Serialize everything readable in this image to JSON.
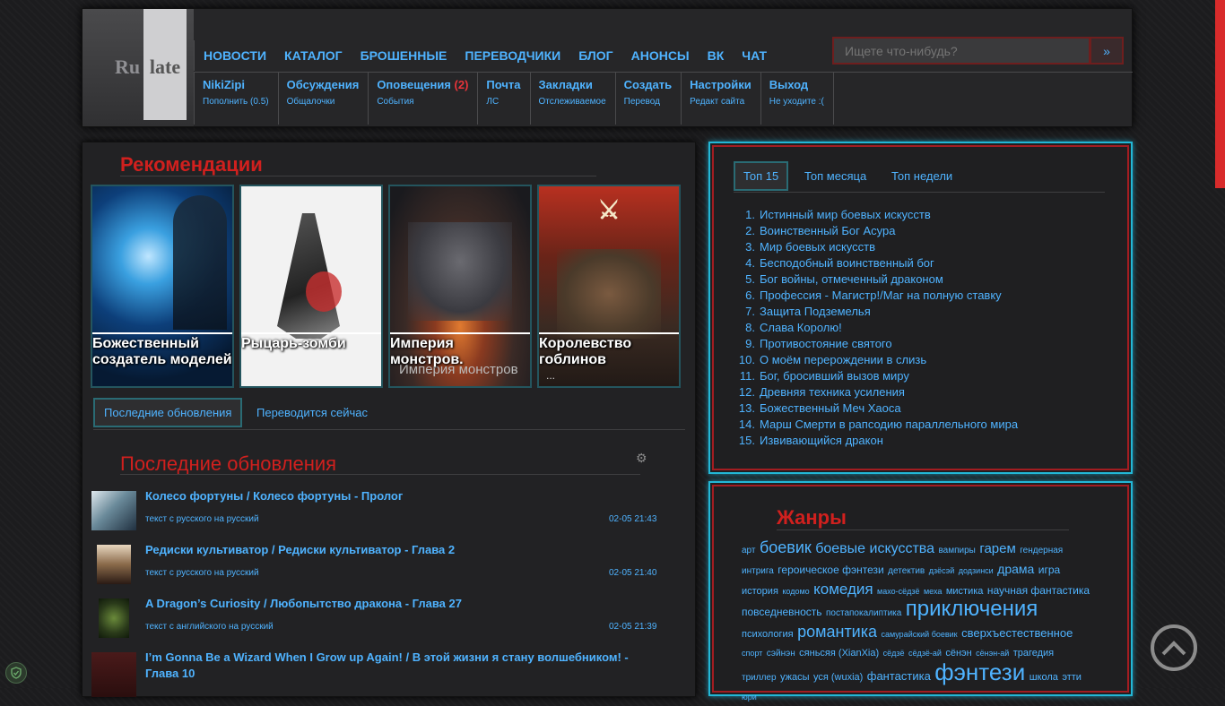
{
  "header": {
    "logo_ru": "Ru",
    "logo_late": "late",
    "nav": [
      "НОВОСТИ",
      "КАТАЛОГ",
      "БРОШЕННЫЕ",
      "ПЕРЕВОДЧИКИ",
      "БЛОГ",
      "АНОНСЫ",
      "ВК",
      "ЧАТ"
    ],
    "search_placeholder": "Ищете что-нибудь?",
    "search_button": "»",
    "subnav": [
      {
        "main": "NikiZipi",
        "sub": "Пополнить (0.5)"
      },
      {
        "main": "Обсуждения",
        "sub": "Общалочки"
      },
      {
        "main": "Оповещения",
        "count": "(2)",
        "sub": "События"
      },
      {
        "main": "Почта",
        "sub": "ЛС"
      },
      {
        "main": "Закладки",
        "sub": "Отслеживаемое"
      },
      {
        "main": "Создать",
        "sub": "Перевод"
      },
      {
        "main": "Настройки",
        "sub": "Редакт сайта"
      },
      {
        "main": "Выход",
        "sub": "Не уходите :("
      }
    ]
  },
  "recommendations": {
    "title": "Рекомендации",
    "cards": [
      {
        "caption": "Божественный создатель моделей"
      },
      {
        "caption": "Рыцарь-зомби"
      },
      {
        "caption": "Империя монстров.",
        "overlay": "Империя монстров"
      },
      {
        "caption": "Королевство гоблинов",
        "overlay": "..."
      }
    ]
  },
  "tabs": {
    "active": "Последние обновления",
    "other": "Переводится сейчас"
  },
  "updates": {
    "title": "Последние обновления",
    "rows": [
      {
        "title": "Колесо фортуны / Колесо фортуны - Пролог",
        "lang": "текст с русского на русский",
        "time": "02-05 21:43"
      },
      {
        "title": "Редиски культиватор / Редиски культиватор - Глава 2",
        "lang": "текст с русского на русский",
        "time": "02-05 21:40"
      },
      {
        "title": "A Dragon’s Curiosity / Любопытство дракона - Глава 27",
        "lang": "текст с английского на русский",
        "time": "02-05 21:39"
      },
      {
        "title": "I’m Gonna Be a Wizard When I Grow up Again! / В этой жизни я стану волшебником! - Глава 10",
        "lang": "",
        "time": ""
      }
    ]
  },
  "top": {
    "tabs": [
      "Топ 15",
      "Топ месяца",
      "Топ недели"
    ],
    "items": [
      "Истинный мир боевых искусств",
      "Воинственный Бог Асура",
      "Мир боевых искусств",
      "Бесподобный воинственный бог",
      "Бог войны, отмеченный драконом",
      "Профессия - Магистр!/Маг на полную ставку",
      "Защита Подземелья",
      "Слава Королю!",
      "Противостояние святого",
      "О моём перерождении в слизь",
      "Бог, бросивший вызов миру",
      "Древняя техника усиления",
      "Божественный Меч Хаоса",
      "Марш Смерти в рапсодию параллельного мира",
      "Извивающийся дракон"
    ]
  },
  "genres": {
    "title": "Жанры",
    "tags": [
      {
        "t": "арт",
        "s": 10
      },
      {
        "t": "боевик",
        "s": 18
      },
      {
        "t": "боевые искусства",
        "s": 16
      },
      {
        "t": "вампиры",
        "s": 10
      },
      {
        "t": "гарем",
        "s": 15
      },
      {
        "t": "гендерная интрига",
        "s": 10
      },
      {
        "t": "героическое фэнтези",
        "s": 12
      },
      {
        "t": "детектив",
        "s": 10
      },
      {
        "t": "дзёсэй",
        "s": 9
      },
      {
        "t": "додзинси",
        "s": 9
      },
      {
        "t": "драма",
        "s": 14
      },
      {
        "t": "игра",
        "s": 12
      },
      {
        "t": "история",
        "s": 11
      },
      {
        "t": "кодомо",
        "s": 9
      },
      {
        "t": "комедия",
        "s": 17
      },
      {
        "t": "махо-сёдзё",
        "s": 9
      },
      {
        "t": "меха",
        "s": 9
      },
      {
        "t": "мистика",
        "s": 11
      },
      {
        "t": "научная фантастика",
        "s": 12
      },
      {
        "t": "повседневность",
        "s": 12
      },
      {
        "t": "постапокалиптика",
        "s": 10
      },
      {
        "t": "приключения",
        "s": 24
      },
      {
        "t": "психология",
        "s": 11
      },
      {
        "t": "романтика",
        "s": 18
      },
      {
        "t": "самурайский боевик",
        "s": 9
      },
      {
        "t": "сверхъестественное",
        "s": 13
      },
      {
        "t": "спорт",
        "s": 9
      },
      {
        "t": "сэйнэн",
        "s": 10
      },
      {
        "t": "сяньсяя (XianXia)",
        "s": 11
      },
      {
        "t": "сёдзё",
        "s": 9
      },
      {
        "t": "сёдзё-ай",
        "s": 9
      },
      {
        "t": "сёнэн",
        "s": 11
      },
      {
        "t": "сёнэн-ай",
        "s": 9
      },
      {
        "t": "трагедия",
        "s": 11
      },
      {
        "t": "триллер",
        "s": 10
      },
      {
        "t": "ужасы",
        "s": 11
      },
      {
        "t": "уся (wuxia)",
        "s": 11
      },
      {
        "t": "фантастика",
        "s": 13
      },
      {
        "t": "фэнтези",
        "s": 26
      },
      {
        "t": "школа",
        "s": 11
      },
      {
        "t": "этти",
        "s": 11
      },
      {
        "t": "юри",
        "s": 9
      }
    ]
  },
  "colors": {
    "accent": "#4fb3ff",
    "title_red": "#d0201e",
    "border_cyan": "#23b7d6",
    "border_red": "#a21d21"
  }
}
